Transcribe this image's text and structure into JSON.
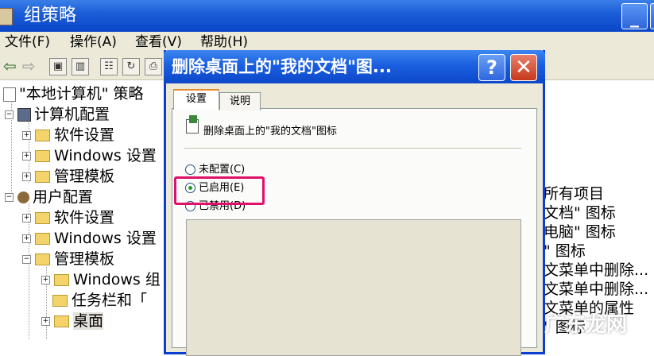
{
  "main_window": {
    "title": "组策略",
    "min_glyph": "_"
  },
  "menu": [
    {
      "label": "文件(F)"
    },
    {
      "label": "操作(A)"
    },
    {
      "label": "查看(V)"
    },
    {
      "label": "帮助(H)"
    }
  ],
  "toolbar": {
    "back_icon": "back-arrow-icon",
    "forward_icon": "forward-arrow-icon"
  },
  "tree": {
    "root": "\"本地计算机\" 策略",
    "computer_config": "计算机配置",
    "software_settings_1": "软件设置",
    "windows_settings_1": "Windows 设置",
    "admin_templates_1": "管理模板",
    "user_config": "用户配置",
    "software_settings_2": "软件设置",
    "windows_settings_2": "Windows 设置",
    "admin_templates_2": "管理模板",
    "windows_components": "Windows 组",
    "taskbar": "任务栏和「",
    "desktop": "桌面"
  },
  "right_list": [
    "所有项目",
    "文档\" 图标",
    "电脑\" 图标",
    "\" 图标",
    "文菜单中删除...",
    "文菜单中删除...",
    "文菜单的属性",
    "\" 图标"
  ],
  "dialog": {
    "title": "删除桌面上的\"我的文档\"图...",
    "help_label": "?",
    "close_label": "✕",
    "tabs": [
      {
        "label": "设置"
      },
      {
        "label": "说明"
      }
    ],
    "setting_name": "删除桌面上的\"我的文档\"图标",
    "options": [
      {
        "label": "未配置(C)",
        "selected": false
      },
      {
        "label": "已启用(E)",
        "selected": true
      },
      {
        "label": "已禁用(D)",
        "selected": false
      }
    ]
  },
  "watermark": "广东龙网",
  "colors": {
    "titlebar": "#1c5ed8",
    "highlight": "#e0106a",
    "selected_radio": "#21a121"
  }
}
